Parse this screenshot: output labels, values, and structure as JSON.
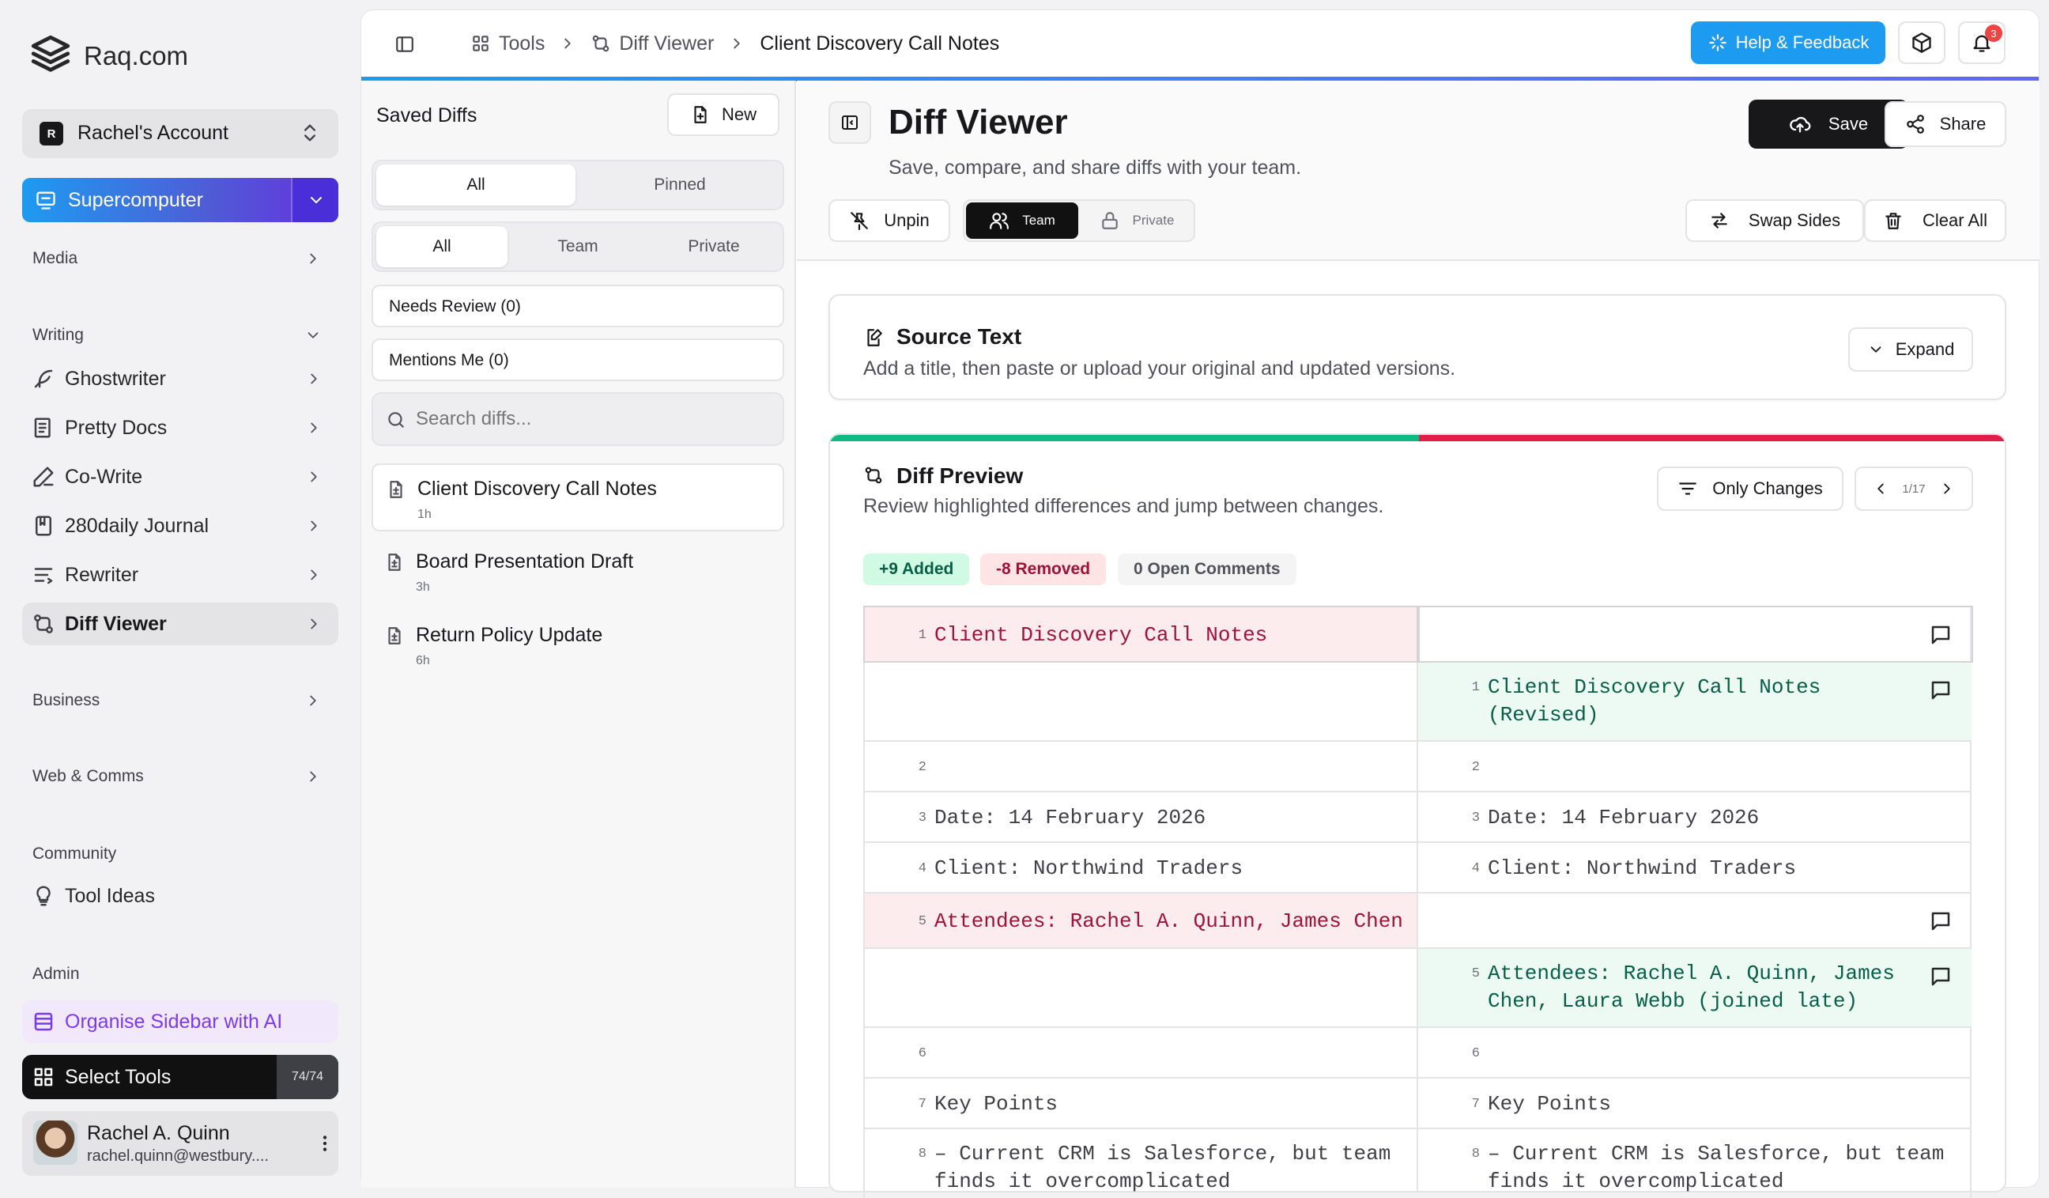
{
  "brand": {
    "name": "Raq.com"
  },
  "account": {
    "initial": "R",
    "name": "Rachel's Account"
  },
  "supercomputer": {
    "label": "Supercomputer"
  },
  "sidebar": {
    "media": "Media",
    "writing": "Writing",
    "writing_items": [
      {
        "label": "Ghostwriter",
        "icon": "feather-icon"
      },
      {
        "label": "Pretty Docs",
        "icon": "document-icon"
      },
      {
        "label": "Co-Write",
        "icon": "pen-icon"
      },
      {
        "label": "280daily Journal",
        "icon": "journal-icon"
      },
      {
        "label": "Rewriter",
        "icon": "lines-icon"
      },
      {
        "label": "Diff Viewer",
        "icon": "diff-icon"
      }
    ],
    "business": "Business",
    "web_comms": "Web & Comms",
    "community": "Community",
    "tool_ideas": "Tool Ideas",
    "admin": "Admin",
    "organise": "Organise Sidebar with AI",
    "select_tools": "Select Tools",
    "tool_count": "74/74"
  },
  "user": {
    "name": "Rachel A. Quinn",
    "email": "rachel.quinn@westbury...."
  },
  "breadcrumb": {
    "tools": "Tools",
    "diff_viewer": "Diff Viewer",
    "current": "Client Discovery Call Notes"
  },
  "header": {
    "help": "Help & Feedback",
    "notifications": "3"
  },
  "saved": {
    "title": "Saved Diffs",
    "new": "New",
    "tabs1": [
      "All",
      "Pinned"
    ],
    "tabs2": [
      "All",
      "Team",
      "Private"
    ],
    "needs_review": "Needs Review (0)",
    "mentions": "Mentions Me (0)",
    "search_placeholder": "Search diffs...",
    "items": [
      {
        "title": "Client Discovery Call Notes",
        "age": "1h"
      },
      {
        "title": "Board Presentation Draft",
        "age": "3h"
      },
      {
        "title": "Return Policy Update",
        "age": "6h"
      }
    ]
  },
  "main": {
    "title": "Diff Viewer",
    "subtitle": "Save, compare, and share diffs with your team.",
    "save": "Save",
    "share": "Share",
    "unpin": "Unpin",
    "team": "Team",
    "private": "Private",
    "swap": "Swap Sides",
    "clear": "Clear All",
    "source_title": "Source Text",
    "source_sub": "Add a title, then paste or upload your original and updated versions.",
    "expand": "Expand",
    "preview_title": "Diff Preview",
    "preview_sub": "Review highlighted differences and jump between changes.",
    "only_changes": "Only Changes",
    "nav": "1/17",
    "added": "+9 Added",
    "removed": "-8 Removed",
    "comments": "0 Open Comments"
  },
  "colors": {
    "accent_blue": "#2f6fe8",
    "help_blue": "#1d9bf0",
    "added": "#10b981",
    "removed": "#e11d48",
    "dark": "#18181b"
  },
  "diff": [
    {
      "type": "del",
      "left_n": "1",
      "left": "Client Discovery Call Notes",
      "right_n": "",
      "right": ""
    },
    {
      "type": "add",
      "left_n": "",
      "left": "",
      "right_n": "1",
      "right": "Client Discovery Call Notes\n(Revised)"
    },
    {
      "type": "eq",
      "left_n": "2",
      "left": "",
      "right_n": "2",
      "right": ""
    },
    {
      "type": "eq",
      "left_n": "3",
      "left": "Date: 14 February 2026",
      "right_n": "3",
      "right": "Date: 14 February 2026"
    },
    {
      "type": "eq",
      "left_n": "4",
      "left": "Client: Northwind Traders",
      "right_n": "4",
      "right": "Client: Northwind Traders"
    },
    {
      "type": "del",
      "left_n": "5",
      "left": "Attendees: Rachel A. Quinn, James Chen",
      "right_n": "",
      "right": ""
    },
    {
      "type": "add",
      "left_n": "",
      "left": "",
      "right_n": "5",
      "right": "Attendees: Rachel A. Quinn, James\nChen, Laura Webb (joined late)"
    },
    {
      "type": "eq",
      "left_n": "6",
      "left": "",
      "right_n": "6",
      "right": ""
    },
    {
      "type": "eq",
      "left_n": "7",
      "left": "Key Points",
      "right_n": "7",
      "right": "Key Points"
    },
    {
      "type": "eq",
      "left_n": "8",
      "left": "– Current CRM is Salesforce, but team\nfinds it overcomplicated",
      "right_n": "8",
      "right": "– Current CRM is Salesforce, but team\nfinds it overcomplicated"
    }
  ]
}
